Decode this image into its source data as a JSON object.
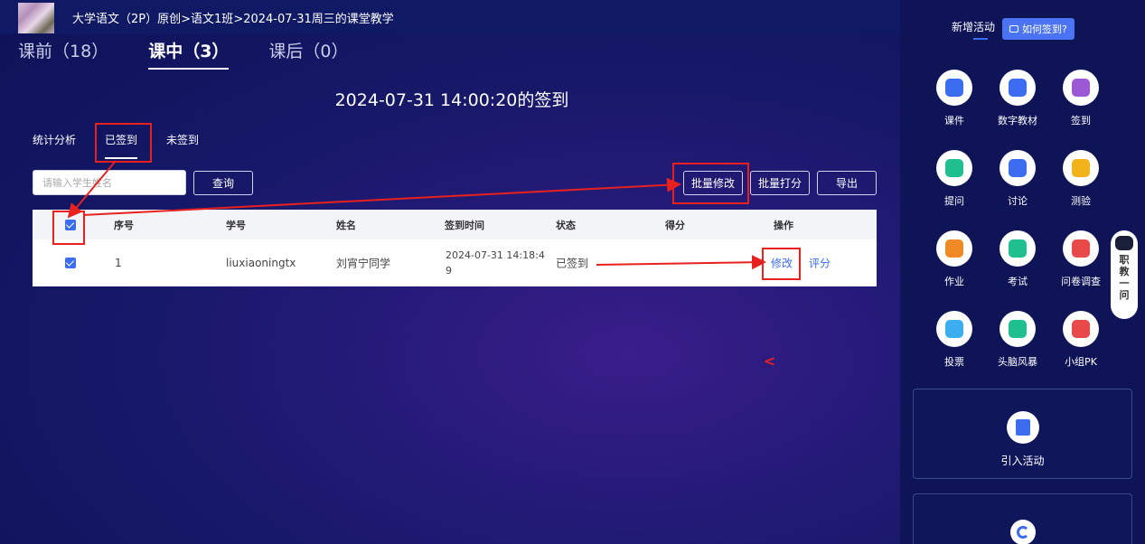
{
  "breadcrumb": {
    "course": "大学语文（2P）原创",
    "sep1": ">",
    "class_name": "语文1班",
    "sep2": ">",
    "session": "2024-07-31周三的课堂教学"
  },
  "phase_tabs": [
    {
      "label": "课前（18）",
      "active": false
    },
    {
      "label": "课中（3）",
      "active": true
    },
    {
      "label": "课后（0）",
      "active": false
    }
  ],
  "sign_title": "2024-07-31 14:00:20的签到",
  "subtabs": [
    {
      "label": "统计分析",
      "active": false
    },
    {
      "label": "已签到",
      "active": true
    },
    {
      "label": "未签到",
      "active": false
    }
  ],
  "search": {
    "placeholder": "请输入学生姓名",
    "button": "查询"
  },
  "actions": {
    "batch_edit": "批量修改",
    "batch_score": "批量打分",
    "export": "导出"
  },
  "table": {
    "headers": [
      "序号",
      "学号",
      "姓名",
      "签到时间",
      "状态",
      "得分",
      "操作"
    ],
    "rows": [
      {
        "index": "1",
        "student_id": "liuxiaoningtx",
        "name": "刘宵宁同学",
        "time_line1": "2024-07-31 14:18:4",
        "time_line2": "9",
        "status": "已签到",
        "score": "",
        "edit": "修改",
        "rate": "评分"
      }
    ]
  },
  "stray_glyph": "<",
  "side": {
    "title": "新增活动",
    "howto": "如何签到?",
    "tools": [
      {
        "label": "课件",
        "icon": "courseware-icon",
        "color": "#3c6df0"
      },
      {
        "label": "数字教材",
        "icon": "digital-textbook-icon",
        "color": "#3c6df0"
      },
      {
        "label": "签到",
        "icon": "checkin-icon",
        "color": "#9b59d6"
      },
      {
        "label": "提问",
        "icon": "question-icon",
        "color": "#1fbf8f"
      },
      {
        "label": "讨论",
        "icon": "discussion-icon",
        "color": "#3c6df0"
      },
      {
        "label": "测验",
        "icon": "quiz-icon",
        "color": "#f2b21a"
      },
      {
        "label": "作业",
        "icon": "homework-icon",
        "color": "#f08a24"
      },
      {
        "label": "考试",
        "icon": "exam-icon",
        "color": "#1fbf8f"
      },
      {
        "label": "问卷调查",
        "icon": "survey-icon",
        "color": "#e84a4a"
      },
      {
        "label": "投票",
        "icon": "vote-icon",
        "color": "#3caef0"
      },
      {
        "label": "头脑风暴",
        "icon": "brainstorm-icon",
        "color": "#1fbf8f"
      },
      {
        "label": "小组PK",
        "icon": "group-pk-icon",
        "color": "#e84a4a"
      }
    ],
    "import_label": "引入活动",
    "assistant_text": [
      "职",
      "教",
      "一",
      "问"
    ]
  }
}
